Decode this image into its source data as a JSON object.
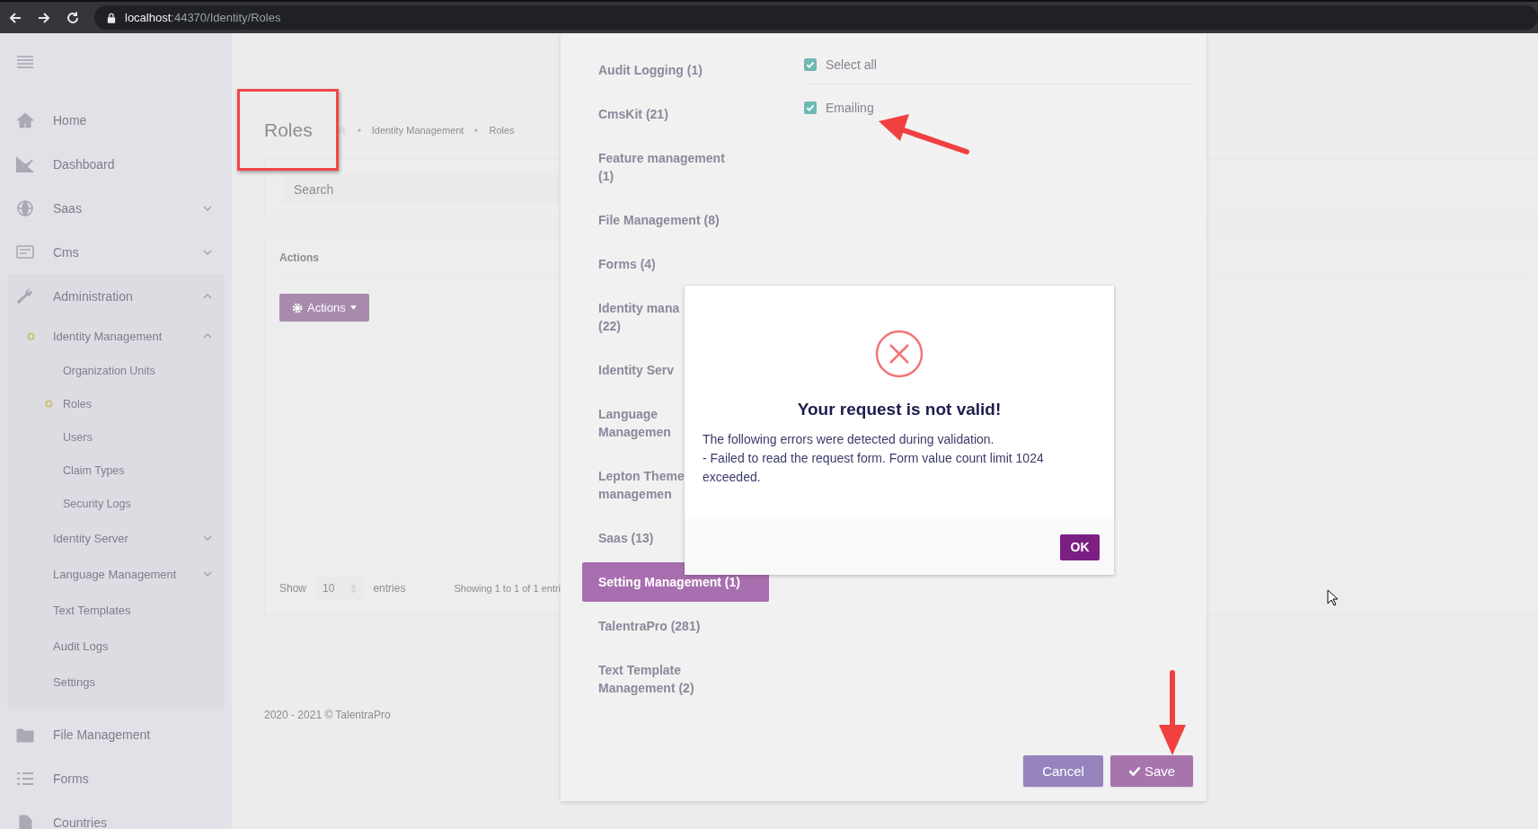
{
  "browser": {
    "address": {
      "host": "localhost",
      "rest": ":44370/Identity/Roles"
    }
  },
  "sidebar": {
    "items": [
      {
        "label": "Home"
      },
      {
        "label": "Dashboard"
      },
      {
        "label": "Saas",
        "expanded": false
      },
      {
        "label": "Cms",
        "expanded": false
      },
      {
        "label": "Administration",
        "expanded": true,
        "children": [
          {
            "label": "Identity Management",
            "expanded": true,
            "active": true,
            "children": [
              {
                "label": "Organization Units",
                "selected": false
              },
              {
                "label": "Roles",
                "selected": true
              },
              {
                "label": "Users",
                "selected": false
              },
              {
                "label": "Claim Types",
                "selected": false
              },
              {
                "label": "Security Logs",
                "selected": false
              }
            ]
          },
          {
            "label": "Identity Server",
            "expanded": false,
            "active": false
          },
          {
            "label": "Language Management",
            "expanded": false,
            "active": false
          },
          {
            "label": "Text Templates",
            "active": false
          },
          {
            "label": "Audit Logs",
            "active": false
          },
          {
            "label": "Settings",
            "active": false
          }
        ]
      },
      {
        "label": "File Management"
      },
      {
        "label": "Forms"
      },
      {
        "label": "Countries"
      }
    ]
  },
  "page": {
    "title": "Roles",
    "breadcrumb": [
      "Identity Management",
      "Roles"
    ],
    "search": {
      "placeholder": "Search"
    },
    "actions_card": {
      "title": "Actions",
      "button": "Actions"
    },
    "table_footer": {
      "show": "Show",
      "page_size": "10",
      "entries": "entries",
      "summary": "Showing 1 to 1 of 1 entri"
    },
    "footer": "2020 - 2021 © TalentraPro"
  },
  "permissions_modal": {
    "groups": [
      {
        "lines": [
          "Audit Logging (1)"
        ],
        "selected": false
      },
      {
        "lines": [
          "CmsKit (21)"
        ],
        "selected": false
      },
      {
        "lines": [
          "Feature management",
          "(1)"
        ],
        "selected": false
      },
      {
        "lines": [
          "File Management (8)"
        ],
        "selected": false
      },
      {
        "lines": [
          "Forms (4)"
        ],
        "selected": false
      },
      {
        "lines": [
          "Identity mana",
          "(22)"
        ],
        "selected": false
      },
      {
        "lines": [
          "Identity Serv"
        ],
        "selected": false
      },
      {
        "lines": [
          "Language",
          "Managemen"
        ],
        "selected": false
      },
      {
        "lines": [
          "Lepton Theme",
          "managemen"
        ],
        "selected": false
      },
      {
        "lines": [
          "Saas (13)"
        ],
        "selected": false
      },
      {
        "lines": [
          "Setting Management (1)"
        ],
        "selected": true
      },
      {
        "lines": [
          "TalentraPro (281)"
        ],
        "selected": false
      },
      {
        "lines": [
          "Text Template",
          "Management (2)"
        ],
        "selected": false
      }
    ],
    "permissions": [
      {
        "label": "Select all",
        "checked": true
      },
      {
        "label": "Emailing",
        "checked": true
      }
    ],
    "buttons": [
      {
        "label": "Cancel",
        "kind": "cancel"
      },
      {
        "label": "Save",
        "kind": "save"
      }
    ]
  },
  "dialog": {
    "title": "Your request is not valid!",
    "message": [
      "The following errors were detected during validation.",
      "- Failed to read the request form. Form value count limit 1024 exceeded."
    ],
    "ok": "OK"
  }
}
